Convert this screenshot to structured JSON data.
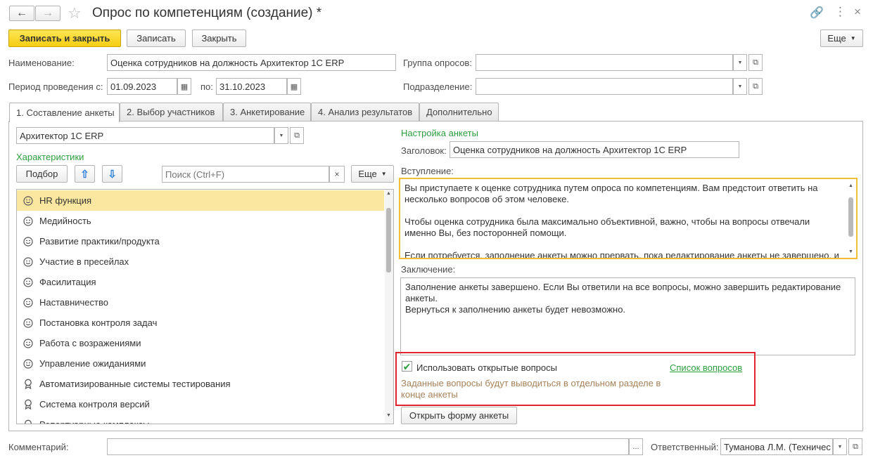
{
  "window": {
    "title": "Опрос по компетенциям (создание) *"
  },
  "toolbar": {
    "save_close": "Записать и закрыть",
    "save": "Записать",
    "close": "Закрыть",
    "more": "Еще"
  },
  "form": {
    "name_label": "Наименование:",
    "name_value": "Оценка сотрудников на должность Архитектор 1С ERP",
    "group_label": "Группа опросов:",
    "group_value": "",
    "period_label": "Период проведения с:",
    "period_from": "01.09.2023",
    "period_to_label": "по:",
    "period_to": "31.10.2023",
    "division_label": "Подразделение:",
    "division_value": ""
  },
  "tabs": [
    {
      "label": "1. Составление анкеты"
    },
    {
      "label": "2. Выбор участников"
    },
    {
      "label": "3. Анкетирование"
    },
    {
      "label": "4. Анализ результатов"
    },
    {
      "label": "Дополнительно"
    }
  ],
  "left": {
    "profile_value": "Архитектор 1С ERP",
    "characteristics_title": "Характеристики",
    "pick_button": "Подбор",
    "search_placeholder": "Поиск (Ctrl+F)",
    "more_button": "Еще",
    "items": [
      {
        "label": "HR функция",
        "icon": "smile-icon",
        "selected": true
      },
      {
        "label": "Медийность",
        "icon": "smile-icon"
      },
      {
        "label": "Развитие практики/продукта",
        "icon": "smile-icon"
      },
      {
        "label": "Участие в пресейлах",
        "icon": "smile-icon"
      },
      {
        "label": "Фасилитация",
        "icon": "smile-icon"
      },
      {
        "label": "Наставничество",
        "icon": "smile-icon"
      },
      {
        "label": "Постановка контроля задач",
        "icon": "smile-icon"
      },
      {
        "label": "Работа с возражениями",
        "icon": "smile-icon"
      },
      {
        "label": "Управление ожиданиями",
        "icon": "smile-icon"
      },
      {
        "label": "Автоматизированные системы тестирования",
        "icon": "award-icon"
      },
      {
        "label": "Система контроля версий",
        "icon": "award-icon"
      },
      {
        "label": "Репертуарные комплексы",
        "icon": "award-icon"
      }
    ]
  },
  "right": {
    "settings_title": "Настройка анкеты",
    "header_label": "Заголовок:",
    "header_value": "Оценка сотрудников на должность Архитектор 1С ERP",
    "intro_label": "Вступление:",
    "intro_text": "Вы приступаете к оценке сотрудника путем опроса по компетенциям. Вам предстоит ответить на несколько вопросов об этом человеке.\n\nЧтобы оценка сотрудника была максимально объективной, важно, чтобы на вопросы отвечали именно Вы, без посторонней помощи.\n\nЕсли потребуется, заполнение анкеты можно прервать, пока редактирование анкеты не завершено, и",
    "conclusion_label": "Заключение:",
    "conclusion_text": "Заполнение анкеты завершено. Если Вы ответили на все вопросы, можно завершить редактирование анкеты.\nВернуться к заполнению анкеты будет невозможно.",
    "open_questions_label": "Использовать открытые вопросы",
    "open_questions_checked": true,
    "questions_list_link": "Список вопросов",
    "open_questions_hint": "Заданные вопросы будут выводиться в отдельном разделе в конце анкеты",
    "open_form_button": "Открыть форму анкеты"
  },
  "footer": {
    "comment_label": "Комментарий:",
    "comment_value": "",
    "responsible_label": "Ответственный:",
    "responsible_value": "Туманова Л.М. (Техничес"
  },
  "colors": {
    "accent_green": "#2d9e3e",
    "primary_button": "#f5cd12",
    "selection": "#fbe7a0",
    "focus_border": "#f0c030",
    "highlight_box": "#e0252e"
  }
}
